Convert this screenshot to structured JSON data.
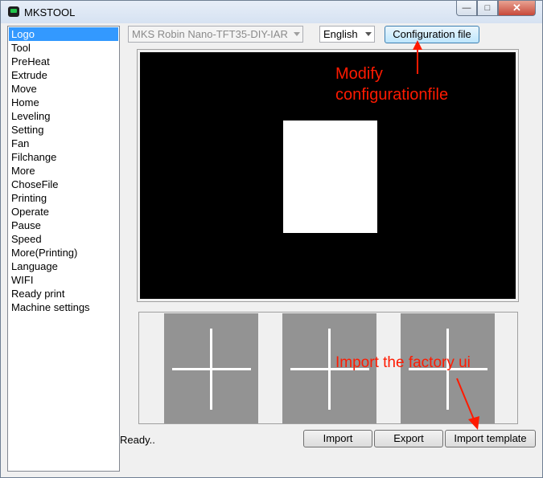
{
  "window": {
    "title": "MKSTOOL"
  },
  "sidebar": {
    "items": [
      {
        "label": "Logo",
        "selected": true
      },
      {
        "label": "Tool"
      },
      {
        "label": "PreHeat"
      },
      {
        "label": "Extrude"
      },
      {
        "label": "Move"
      },
      {
        "label": "Home"
      },
      {
        "label": "Leveling"
      },
      {
        "label": "Setting"
      },
      {
        "label": "Fan"
      },
      {
        "label": "Filchange"
      },
      {
        "label": "More"
      },
      {
        "label": "ChoseFile"
      },
      {
        "label": "Printing"
      },
      {
        "label": "Operate"
      },
      {
        "label": "Pause"
      },
      {
        "label": "Speed"
      },
      {
        "label": "More(Printing)"
      },
      {
        "label": "Language"
      },
      {
        "label": "WIFI"
      },
      {
        "label": "Ready print"
      },
      {
        "label": "Machine settings"
      }
    ]
  },
  "toolbar": {
    "board_select": "MKS Robin Nano-TFT35-DIY-IAR",
    "language_select": "English",
    "config_button": "Configuration file"
  },
  "annotations": {
    "modify_line1": "Modify",
    "modify_line2": "configurationfile",
    "import_factory": "Import the factory ui",
    "color": "#ff1a00"
  },
  "bottom": {
    "status": "Ready..",
    "import_button": "Import",
    "export_button": "Export",
    "import_template_button": "Import template"
  },
  "colors": {
    "selection": "#3399ff",
    "preview_bg": "#000000",
    "thumb_bg": "#939393"
  }
}
